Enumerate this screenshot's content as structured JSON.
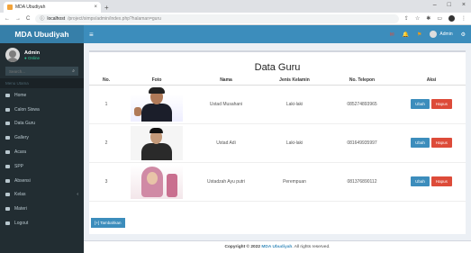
{
  "browser": {
    "tab_title": "MDA Ubudiyah",
    "url_host": "localhost",
    "url_path": "/project/simps/admin/index.php?halaman=guru"
  },
  "sidebar": {
    "logo": "MDA Ubudiyah",
    "user_name": "Admin",
    "user_status": "Online",
    "search_placeholder": "Search...",
    "menu_header": "Menu Utama",
    "items": [
      {
        "label": "Home"
      },
      {
        "label": "Calon Siswa"
      },
      {
        "label": "Data Guru"
      },
      {
        "label": "Gallery"
      },
      {
        "label": "Acara"
      },
      {
        "label": "SPP"
      },
      {
        "label": "Absensi"
      },
      {
        "label": "Kelas"
      },
      {
        "label": "Materi"
      },
      {
        "label": "Logout"
      }
    ]
  },
  "topnav": {
    "admin_label": "Admin"
  },
  "page": {
    "title": "Data Guru",
    "columns": [
      "No.",
      "Foto",
      "Nama",
      "Jenis Kelamin",
      "No. Telepon",
      "Aksi"
    ],
    "rows": [
      {
        "no": "1",
        "nama": "Ustad Musahani",
        "jk": "Laki-laki",
        "telp": "085274893965"
      },
      {
        "no": "2",
        "nama": "Ustad Adi",
        "jk": "Laki-laki",
        "telp": "081649935997"
      },
      {
        "no": "3",
        "nama": "Ustadzah Ayu putri",
        "jk": "Perempuan",
        "telp": "081376890112"
      }
    ],
    "edit_label": "Ubah",
    "delete_label": "Hapus",
    "add_label": "[+] Tambahkan"
  },
  "footer": {
    "copyright": "Copyright © 2022",
    "brand": "MDA Ubudiyah",
    "rights": ". All rights reserved."
  },
  "colors": {
    "accent": "#3c8dbc",
    "danger": "#dd4b39",
    "sidebar_bg": "#222d32"
  }
}
